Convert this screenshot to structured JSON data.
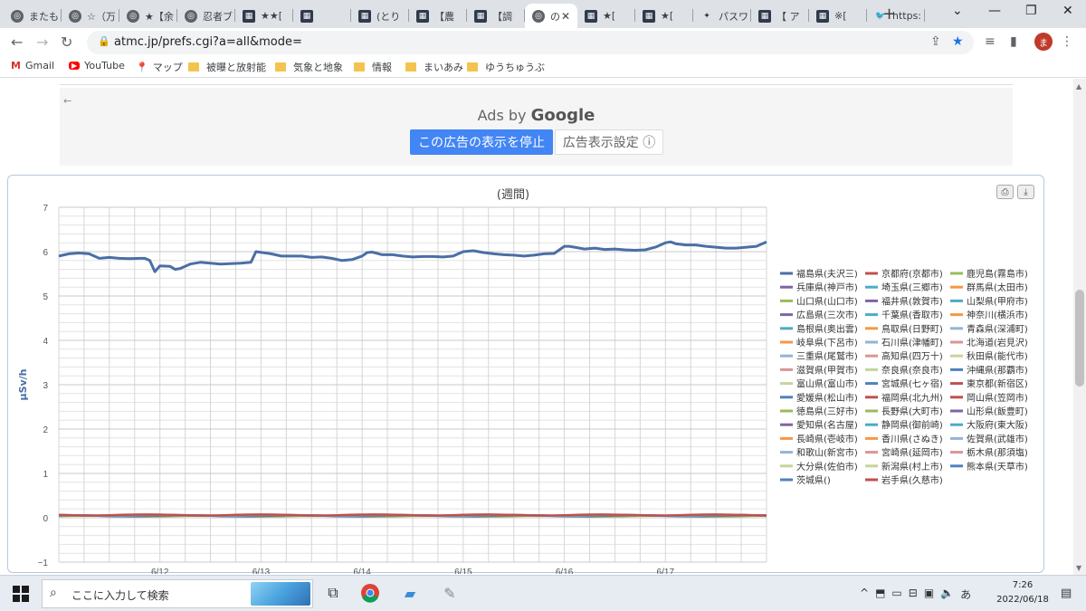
{
  "browser": {
    "tabs": [
      {
        "label": "またも",
        "icon": "globe"
      },
      {
        "label": "☆（万",
        "icon": "globe"
      },
      {
        "label": "★【余",
        "icon": "globe"
      },
      {
        "label": "忍者ブ",
        "icon": "globe"
      },
      {
        "label": "★★[",
        "icon": "dark"
      },
      {
        "label": "",
        "icon": "dark"
      },
      {
        "label": "(とり",
        "icon": "dark"
      },
      {
        "label": "【農",
        "icon": "dark"
      },
      {
        "label": "【調",
        "icon": "dark"
      },
      {
        "label": "の",
        "icon": "globe",
        "active": true
      },
      {
        "label": "★[",
        "icon": "dark"
      },
      {
        "label": "★[",
        "icon": "dark"
      },
      {
        "label": "パスワ",
        "icon": "star"
      },
      {
        "label": "【 ア",
        "icon": "dark"
      },
      {
        "label": "※[",
        "icon": "dark"
      },
      {
        "label": "https:",
        "icon": "twitter"
      }
    ],
    "new_tab": "+",
    "url": "atmc.jp/prefs.cgi?a=all&mode=",
    "avatar_letter": "ま",
    "bookmarks": [
      {
        "label": "Gmail",
        "icon": "gmail"
      },
      {
        "label": "YouTube",
        "icon": "youtube"
      },
      {
        "label": "マップ",
        "icon": "maps"
      },
      {
        "label": "被曝と放射能",
        "icon": "folder"
      },
      {
        "label": "気象と地象",
        "icon": "folder"
      },
      {
        "label": "情報",
        "icon": "folder"
      },
      {
        "label": "まいあみ",
        "icon": "folder"
      },
      {
        "label": "ゆうちゅうぶ",
        "icon": "folder"
      }
    ]
  },
  "ad": {
    "ads_by": "Ads by",
    "google": "Google",
    "stop_label": "この広告の表示を停止",
    "settings_label": "広告表示設定 ⓘ"
  },
  "chart_data": {
    "type": "line",
    "title": "(週間)",
    "ylabel": "μSv/h",
    "ylim": [
      -1,
      7
    ],
    "yticks": [
      -1,
      0,
      1,
      2,
      3,
      4,
      5,
      6,
      7
    ],
    "xticks": [
      "6/12",
      "6/13",
      "6/14",
      "6/15",
      "6/16",
      "6/17"
    ],
    "xrange_days": [
      11.0,
      18.0
    ],
    "xtick_days": [
      12.0,
      13.0,
      14.0,
      15.0,
      16.0,
      17.0
    ],
    "grid": true,
    "legend_position": "right",
    "highlight_series": {
      "name": "福島県(夫沢三)",
      "color": "#4a6fa5",
      "points": [
        [
          11.0,
          5.9
        ],
        [
          11.1,
          5.95
        ],
        [
          11.2,
          5.97
        ],
        [
          11.3,
          5.95
        ],
        [
          11.4,
          5.85
        ],
        [
          11.5,
          5.87
        ],
        [
          11.6,
          5.85
        ],
        [
          11.7,
          5.84
        ],
        [
          11.8,
          5.85
        ],
        [
          11.85,
          5.85
        ],
        [
          11.9,
          5.8
        ],
        [
          11.95,
          5.55
        ],
        [
          12.0,
          5.68
        ],
        [
          12.1,
          5.67
        ],
        [
          12.15,
          5.6
        ],
        [
          12.2,
          5.62
        ],
        [
          12.3,
          5.72
        ],
        [
          12.4,
          5.76
        ],
        [
          12.5,
          5.74
        ],
        [
          12.6,
          5.72
        ],
        [
          12.7,
          5.73
        ],
        [
          12.8,
          5.74
        ],
        [
          12.9,
          5.76
        ],
        [
          12.95,
          6.0
        ],
        [
          13.1,
          5.95
        ],
        [
          13.2,
          5.9
        ],
        [
          13.3,
          5.9
        ],
        [
          13.4,
          5.9
        ],
        [
          13.5,
          5.87
        ],
        [
          13.6,
          5.88
        ],
        [
          13.7,
          5.85
        ],
        [
          13.8,
          5.8
        ],
        [
          13.9,
          5.82
        ],
        [
          14.0,
          5.9
        ],
        [
          14.05,
          5.98
        ],
        [
          14.1,
          5.99
        ],
        [
          14.2,
          5.93
        ],
        [
          14.3,
          5.93
        ],
        [
          14.4,
          5.9
        ],
        [
          14.5,
          5.88
        ],
        [
          14.6,
          5.89
        ],
        [
          14.7,
          5.89
        ],
        [
          14.8,
          5.88
        ],
        [
          14.9,
          5.9
        ],
        [
          15.0,
          6.0
        ],
        [
          15.1,
          6.02
        ],
        [
          15.2,
          5.98
        ],
        [
          15.3,
          5.95
        ],
        [
          15.4,
          5.93
        ],
        [
          15.5,
          5.92
        ],
        [
          15.6,
          5.9
        ],
        [
          15.7,
          5.92
        ],
        [
          15.8,
          5.95
        ],
        [
          15.9,
          5.96
        ],
        [
          16.0,
          6.12
        ],
        [
          16.05,
          6.12
        ],
        [
          16.1,
          6.1
        ],
        [
          16.2,
          6.06
        ],
        [
          16.3,
          6.08
        ],
        [
          16.4,
          6.05
        ],
        [
          16.5,
          6.06
        ],
        [
          16.6,
          6.04
        ],
        [
          16.7,
          6.03
        ],
        [
          16.8,
          6.04
        ],
        [
          16.9,
          6.1
        ],
        [
          17.0,
          6.2
        ],
        [
          17.05,
          6.22
        ],
        [
          17.1,
          6.18
        ],
        [
          17.2,
          6.15
        ],
        [
          17.3,
          6.15
        ],
        [
          17.4,
          6.12
        ],
        [
          17.5,
          6.1
        ],
        [
          17.6,
          6.08
        ],
        [
          17.7,
          6.08
        ],
        [
          17.8,
          6.1
        ],
        [
          17.9,
          6.12
        ],
        [
          18.0,
          6.22
        ]
      ]
    },
    "low_series_level": 0.05,
    "legend": [
      {
        "name": "福島県(夫沢三)",
        "color": "#4a6fa5"
      },
      {
        "name": "京都府(京都市)",
        "color": "#c0504d"
      },
      {
        "name": "鹿児島(霧島市)",
        "color": "#9bbb59"
      },
      {
        "name": "兵庫県(神戸市)",
        "color": "#8064a2"
      },
      {
        "name": "埼玉県(三郷市)",
        "color": "#4bacc6"
      },
      {
        "name": "群馬県(太田市)",
        "color": "#f79646"
      },
      {
        "name": "山口県(山口市)",
        "color": "#9bbb59"
      },
      {
        "name": "福井県(敦賀市)",
        "color": "#8064a2"
      },
      {
        "name": "山梨県(甲府市)",
        "color": "#4bacc6"
      },
      {
        "name": "広島県(三次市)",
        "color": "#8064a2"
      },
      {
        "name": "千葉県(香取市)",
        "color": "#4bacc6"
      },
      {
        "name": "神奈川(横浜市)",
        "color": "#f79646"
      },
      {
        "name": "島根県(奥出雲)",
        "color": "#4bacc6"
      },
      {
        "name": "鳥取県(日野町)",
        "color": "#f79646"
      },
      {
        "name": "青森県(深浦町)",
        "color": "#95b3d7"
      },
      {
        "name": "岐阜県(下呂市)",
        "color": "#f79646"
      },
      {
        "name": "石川県(津幡町)",
        "color": "#95b3d7"
      },
      {
        "name": "北海道(岩見沢)",
        "color": "#d99694"
      },
      {
        "name": "三重県(尾鷲市)",
        "color": "#95b3d7"
      },
      {
        "name": "高知県(四万十)",
        "color": "#d99694"
      },
      {
        "name": "秋田県(能代市)",
        "color": "#c3d69b"
      },
      {
        "name": "滋賀県(甲賀市)",
        "color": "#d99694"
      },
      {
        "name": "奈良県(奈良市)",
        "color": "#c3d69b"
      },
      {
        "name": "沖縄県(那覇市)",
        "color": "#4f81bd"
      },
      {
        "name": "富山県(富山市)",
        "color": "#c3d69b"
      },
      {
        "name": "宮城県(七ヶ宿)",
        "color": "#4f81bd"
      },
      {
        "name": "東京都(新宿区)",
        "color": "#c0504d"
      },
      {
        "name": "愛媛県(松山市)",
        "color": "#4f81bd"
      },
      {
        "name": "福岡県(北九州)",
        "color": "#c0504d"
      },
      {
        "name": "岡山県(笠岡市)",
        "color": "#c0504d"
      },
      {
        "name": "徳島県(三好市)",
        "color": "#9bbb59"
      },
      {
        "name": "長野県(大町市)",
        "color": "#9bbb59"
      },
      {
        "name": "山形県(飯豊町)",
        "color": "#8064a2"
      },
      {
        "name": "愛知県(名古屋)",
        "color": "#8064a2"
      },
      {
        "name": "静岡県(御前崎)",
        "color": "#4bacc6"
      },
      {
        "name": "大阪府(東大阪)",
        "color": "#4bacc6"
      },
      {
        "name": "長崎県(壱岐市)",
        "color": "#f79646"
      },
      {
        "name": "香川県(さぬき)",
        "color": "#f79646"
      },
      {
        "name": "佐賀県(武雄市)",
        "color": "#95b3d7"
      },
      {
        "name": "和歌山(新宮市)",
        "color": "#95b3d7"
      },
      {
        "name": "宮崎県(延岡市)",
        "color": "#d99694"
      },
      {
        "name": "栃木県(那須塩)",
        "color": "#d99694"
      },
      {
        "name": "大分県(佐伯市)",
        "color": "#c3d69b"
      },
      {
        "name": "新潟県(村上市)",
        "color": "#c3d69b"
      },
      {
        "name": "熊本県(天草市)",
        "color": "#4f81bd"
      },
      {
        "name": "茨城県()",
        "color": "#4f81bd"
      },
      {
        "name": "岩手県(久慈市)",
        "color": "#c0504d"
      }
    ]
  },
  "taskbar": {
    "search_placeholder": "ここに入力して検索",
    "time": "7:26",
    "date": "2022/06/18",
    "ime": "あ"
  }
}
